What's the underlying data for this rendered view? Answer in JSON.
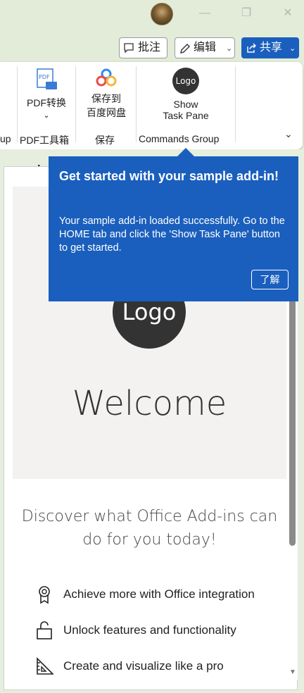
{
  "titlebar": {
    "minimize": "—",
    "restore": "❐",
    "close": "✕"
  },
  "actions": {
    "comment_label": "批注",
    "edit_label": "编辑",
    "share_label": "共享"
  },
  "ribbon": {
    "partial_group_label": "up",
    "pdf_convert_label": "PDF转换",
    "pdf_group_label": "PDF工具箱",
    "save_baidu_label_1": "保存到",
    "save_baidu_label_2": "百度网盘",
    "save_group_label": "保存",
    "logo_text": "Logo",
    "show_task_pane_1": "Show",
    "show_task_pane_2": "Task Pane",
    "commands_group_label": "Commands Group"
  },
  "document": {
    "title": "wordn"
  },
  "taskpane": {
    "logo_text": "Logo",
    "welcome": "Welcome",
    "discover": "Discover what Office Add-ins can do for you today!",
    "features": [
      "Achieve more with Office integration",
      "Unlock features and functionality",
      "Create and visualize like a pro"
    ]
  },
  "callout": {
    "title": "Get started with your sample add-in!",
    "body": "Your sample add-in loaded successfully. Go to the HOME tab and click the 'Show Task Pane' button to get started.",
    "button": "了解"
  }
}
